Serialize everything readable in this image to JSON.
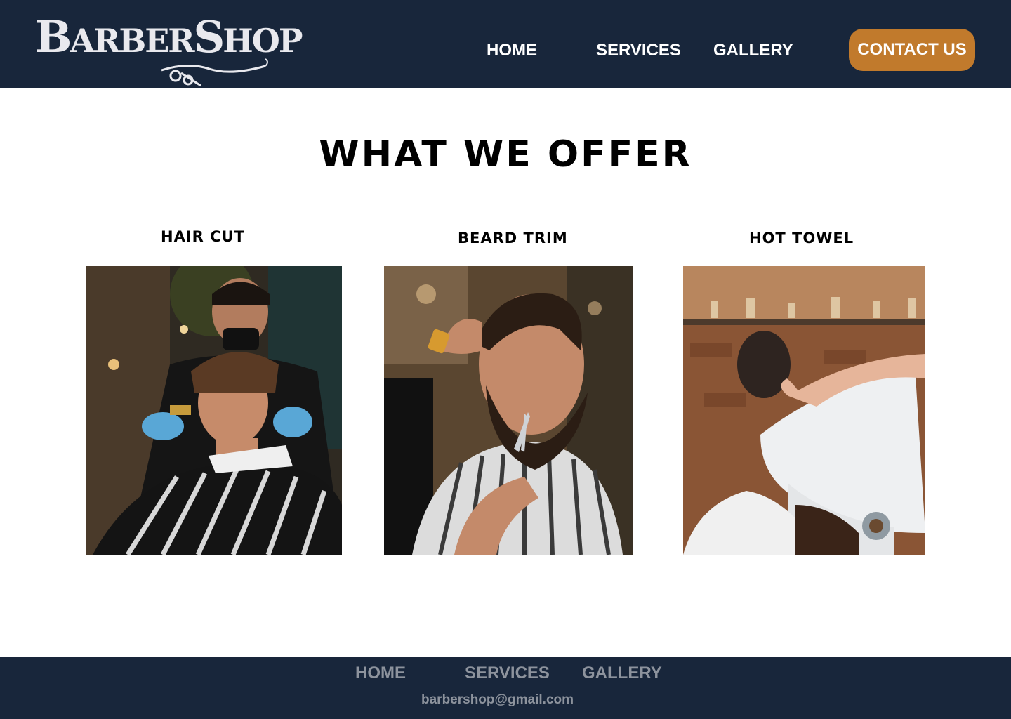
{
  "brand": {
    "logo_text_big_1": "B",
    "logo_text_small_1": "ARBER",
    "logo_text_big_2": "S",
    "logo_text_small_2": "HOP"
  },
  "header": {
    "nav": {
      "home": "HOME",
      "services": "SERVICES",
      "gallery": "GALLERY"
    },
    "contact_label": "CONTACT US"
  },
  "main": {
    "title": "WHAT WE OFFER",
    "services": [
      {
        "title": "HAIR CUT"
      },
      {
        "title": "BEARD TRIM"
      },
      {
        "title": "HOT TOWEL"
      }
    ]
  },
  "footer": {
    "nav": {
      "home": "HOME",
      "services": "SERVICES",
      "gallery": "GALLERY"
    },
    "email": "barbershop@gmail.com"
  },
  "colors": {
    "navy": "#18263b",
    "accent": "#c17a2c",
    "footer_text": "#8d939d"
  }
}
